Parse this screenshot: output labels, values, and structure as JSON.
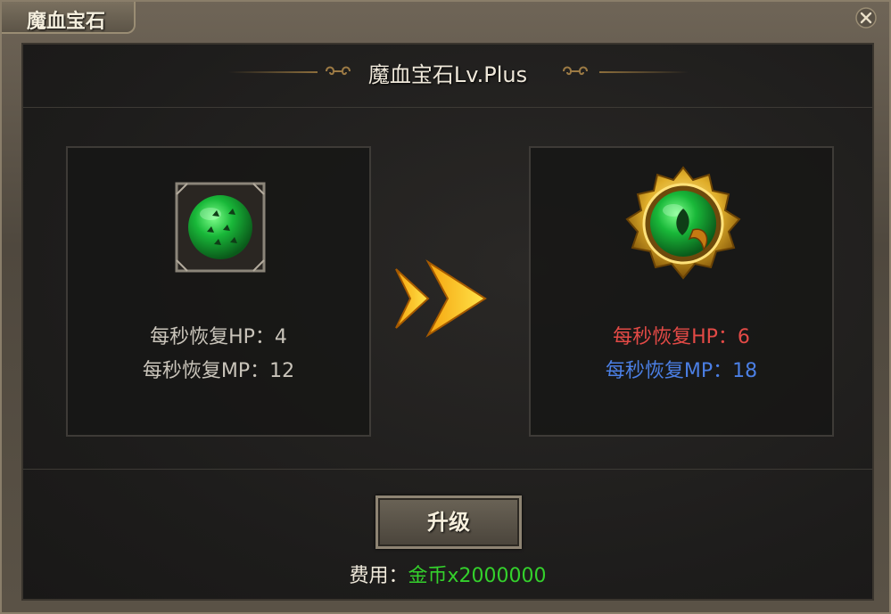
{
  "window": {
    "title": "魔血宝石"
  },
  "header": {
    "title": "魔血宝石Lv.Plus"
  },
  "current": {
    "hp_label": "每秒恢复HP：",
    "hp_value": "4",
    "mp_label": "每秒恢复MP：",
    "mp_value": "12",
    "gem_icon": "green-gem-square-icon"
  },
  "upgraded": {
    "hp_label": "每秒恢复HP：",
    "hp_value": "6",
    "mp_label": "每秒恢复MP：",
    "mp_value": "18",
    "gem_icon": "green-gem-gold-round-icon",
    "hp_color": "#e34a46",
    "mp_color": "#4b7fe4"
  },
  "actions": {
    "upgrade_label": "升级"
  },
  "cost": {
    "label": "费用：",
    "value": "金币x2000000",
    "value_color": "#34d12c"
  }
}
